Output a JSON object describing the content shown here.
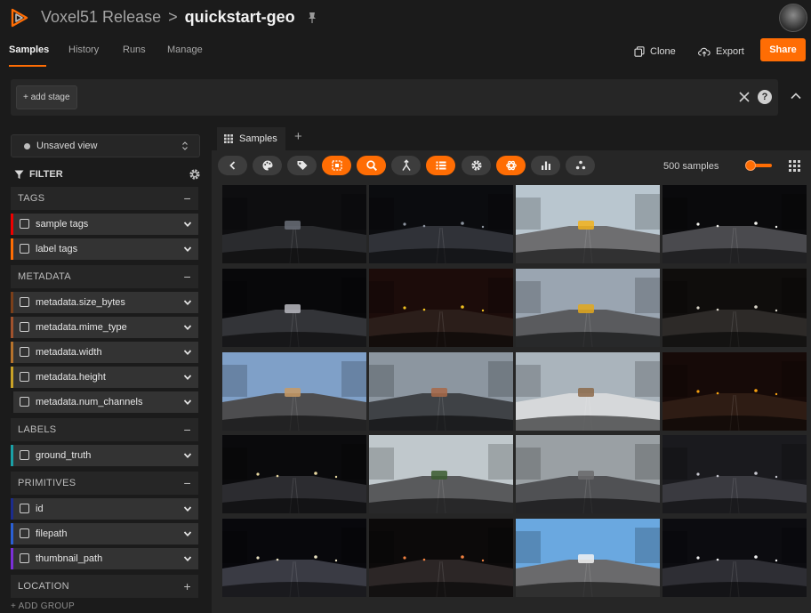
{
  "header": {
    "team": "Voxel51 Release",
    "separator": ">",
    "dataset": "quickstart-geo"
  },
  "nav": {
    "tabs": [
      {
        "label": "Samples",
        "active": true
      },
      {
        "label": "History"
      },
      {
        "label": "Runs"
      },
      {
        "label": "Manage"
      }
    ],
    "clone_label": "Clone",
    "export_label": "Export",
    "share_label": "Share"
  },
  "viewbar": {
    "add_stage_label": "+ add stage",
    "help_label": "?"
  },
  "sidebar": {
    "view_select": "Unsaved view",
    "filter_label": "FILTER",
    "groups": [
      {
        "label": "TAGS",
        "toggle": "−",
        "fields": [
          {
            "label": "sample tags",
            "color": "#ee0000"
          },
          {
            "label": "label tags",
            "color": "#ff6d04"
          }
        ]
      },
      {
        "label": "METADATA",
        "toggle": "−",
        "fields": [
          {
            "label": "metadata.size_bytes",
            "color": "#7a3f1a"
          },
          {
            "label": "metadata.mime_type",
            "color": "#a0522d"
          },
          {
            "label": "metadata.width",
            "color": "#b5722c"
          },
          {
            "label": "metadata.height",
            "color": "#c9a227"
          },
          {
            "label": "metadata.num_channels",
            "color": "#1a1a1a"
          }
        ]
      },
      {
        "label": "LABELS",
        "toggle": "−",
        "fields": [
          {
            "label": "ground_truth",
            "color": "#1aa0a6"
          }
        ]
      },
      {
        "label": "PRIMITIVES",
        "toggle": "−",
        "fields": [
          {
            "label": "id",
            "color": "#1c2c8c"
          },
          {
            "label": "filepath",
            "color": "#2a5fd4"
          },
          {
            "label": "thumbnail_path",
            "color": "#7b2fd8"
          }
        ]
      },
      {
        "label": "LOCATION",
        "toggle": "+",
        "fields": []
      }
    ],
    "add_group_label": "+ ADD GROUP"
  },
  "panel": {
    "tab_label": "Samples",
    "sample_count": "500 samples",
    "accent": "#ff6d04"
  },
  "grid": {
    "tiles": [
      {
        "sky": "#0e0e10",
        "road": "#2a2b2e",
        "light": "#6a6f78",
        "lights": false
      },
      {
        "sky": "#0b0c0f",
        "road": "#303238",
        "light": "#8d949f",
        "lights": true
      },
      {
        "sky": "#b9c6cf",
        "road": "#6e6e70",
        "light": "#f2b21b",
        "lights": false
      },
      {
        "sky": "#0a0a0c",
        "road": "#4a4a4e",
        "light": "#f5f5f0",
        "lights": true
      },
      {
        "sky": "#08080a",
        "road": "#333438",
        "light": "#b8b8c0",
        "lights": false
      },
      {
        "sky": "#1c0c0a",
        "road": "#2b1e1a",
        "light": "#f0c020",
        "lights": true
      },
      {
        "sky": "#9aa5b1",
        "road": "#5a5b5e",
        "light": "#e3a81c",
        "lights": false
      },
      {
        "sky": "#0f0d0c",
        "road": "#2d2a28",
        "light": "#d8d4c8",
        "lights": true
      },
      {
        "sky": "#7fa0c8",
        "road": "#4d4d4f",
        "light": "#c89a64",
        "lights": false
      },
      {
        "sky": "#8c96a0",
        "road": "#3f4246",
        "light": "#a86848",
        "lights": false
      },
      {
        "sky": "#aab4bc",
        "road": "#d6d8da",
        "light": "#8c6a4a",
        "lights": false
      },
      {
        "sky": "#160a08",
        "road": "#2e1c14",
        "light": "#f5a010",
        "lights": true
      },
      {
        "sky": "#0a0a0c",
        "road": "#2c2c30",
        "light": "#e8d8a0",
        "lights": true
      },
      {
        "sky": "#c0c8cc",
        "road": "#595a5c",
        "light": "#3a5a2e",
        "lights": false
      },
      {
        "sky": "#9aa0a4",
        "road": "#505154",
        "light": "#6a6a6c",
        "lights": false
      },
      {
        "sky": "#1a1a1e",
        "road": "#3a3a40",
        "light": "#c8c8d0",
        "lights": true
      },
      {
        "sky": "#08080c",
        "road": "#3a3b44",
        "light": "#e8e0c0",
        "lights": true
      },
      {
        "sky": "#0c0a0a",
        "road": "#2c2626",
        "light": "#f08040",
        "lights": true
      },
      {
        "sky": "#6aa8e0",
        "road": "#6a6a6c",
        "light": "#f2f2f2",
        "lights": false
      },
      {
        "sky": "#0c0c10",
        "road": "#2e2e34",
        "light": "#f0f0f0",
        "lights": true
      }
    ]
  }
}
